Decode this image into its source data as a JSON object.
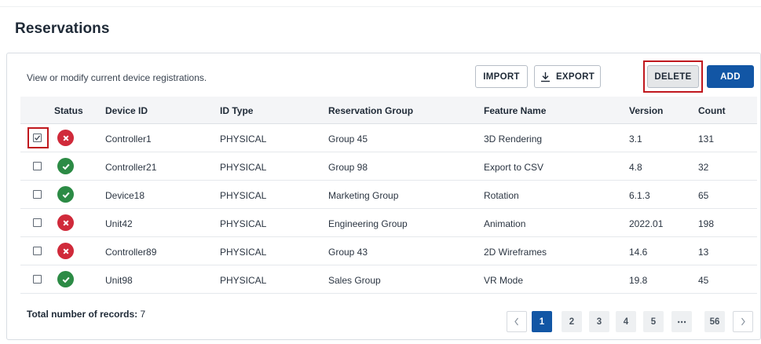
{
  "page": {
    "title": "Reservations"
  },
  "toolbar": {
    "description": "View or modify current device registrations.",
    "import_label": "IMPORT",
    "export_label": "EXPORT",
    "delete_label": "DELETE",
    "add_label": "ADD"
  },
  "table": {
    "headers": {
      "status": "Status",
      "device_id": "Device ID",
      "id_type": "ID Type",
      "group": "Reservation Group",
      "feature": "Feature Name",
      "version": "Version",
      "count": "Count"
    },
    "rows": [
      {
        "checked": true,
        "status": "error",
        "device_id": "Controller1",
        "id_type": "PHYSICAL",
        "group": "Group 45",
        "feature": "3D Rendering",
        "version": "3.1",
        "count": "131"
      },
      {
        "checked": false,
        "status": "ok",
        "device_id": "Controller21",
        "id_type": "PHYSICAL",
        "group": "Group 98",
        "feature": "Export to CSV",
        "version": "4.8",
        "count": "32"
      },
      {
        "checked": false,
        "status": "ok",
        "device_id": "Device18",
        "id_type": "PHYSICAL",
        "group": "Marketing Group",
        "feature": "Rotation",
        "version": "6.1.3",
        "count": "65"
      },
      {
        "checked": false,
        "status": "error",
        "device_id": "Unit42",
        "id_type": "PHYSICAL",
        "group": "Engineering Group",
        "feature": "Animation",
        "version": "2022.01",
        "count": "198"
      },
      {
        "checked": false,
        "status": "error",
        "device_id": "Controller89",
        "id_type": "PHYSICAL",
        "group": "Group 43",
        "feature": "2D Wireframes",
        "version": "14.6",
        "count": "13"
      },
      {
        "checked": false,
        "status": "ok",
        "device_id": "Unit98",
        "id_type": "PHYSICAL",
        "group": "Sales Group",
        "feature": "VR Mode",
        "version": "19.8",
        "count": "45"
      }
    ]
  },
  "footer": {
    "total_label": "Total number of records:",
    "total_value": "7"
  },
  "pagination": {
    "prev_icon": "chevron-left-icon",
    "next_icon": "chevron-right-icon",
    "pages": [
      "1",
      "2",
      "3",
      "4",
      "5",
      "⋯",
      "56"
    ],
    "current": "1"
  },
  "colors": {
    "accent": "#1256a5",
    "error": "#d02a3a",
    "ok": "#2c8b45",
    "highlight": "#c0181e"
  }
}
